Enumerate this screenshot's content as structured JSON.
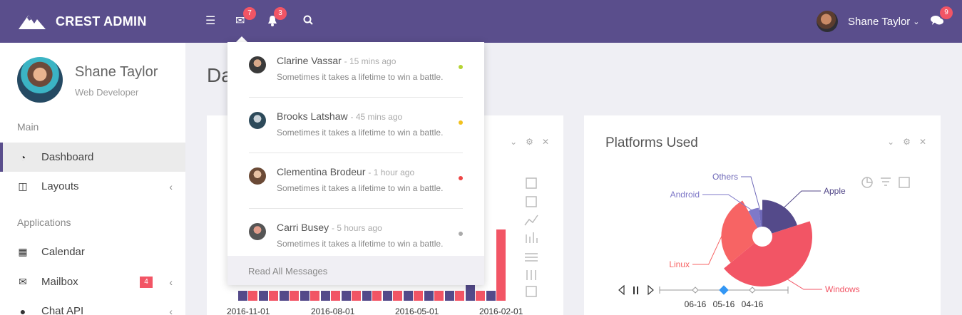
{
  "brand": {
    "name": "CREST ADMIN"
  },
  "topbar": {
    "mail_badge": "7",
    "bell_badge": "3",
    "user_name": "Shane Taylor",
    "chat_badge": "9"
  },
  "sidebar": {
    "user_name": "Shane Taylor",
    "user_role": "Web Developer",
    "sections": [
      "Main",
      "Applications"
    ],
    "items": [
      {
        "label": "Dashboard"
      },
      {
        "label": "Layouts"
      },
      {
        "label": "Calendar"
      },
      {
        "label": "Mailbox",
        "badge": "4"
      },
      {
        "label": "Chat API"
      }
    ]
  },
  "page": {
    "title": "Dashboard"
  },
  "messages": {
    "items": [
      {
        "name": "Clarine Vassar",
        "time": "- 15 mins ago",
        "text": "Sometimes it takes a lifetime to win a battle.",
        "dot_color": "#b5d334"
      },
      {
        "name": "Brooks Latshaw",
        "time": "- 45 mins ago",
        "text": "Sometimes it takes a lifetime to win a battle.",
        "dot_color": "#f2c11d"
      },
      {
        "name": "Clementina Brodeur",
        "time": "- 1 hour ago",
        "text": "Sometimes it takes a lifetime to win a battle.",
        "dot_color": "#ee4545"
      },
      {
        "name": "Carri Busey",
        "time": "- 5 hours ago",
        "text": "Sometimes it takes a lifetime to win a battle.",
        "dot_color": "#aaaaaa"
      }
    ],
    "footer": "Read All Messages"
  },
  "charts": {
    "left": {
      "x_ticks": [
        "2016-11-01",
        "2016-08-01",
        "2016-05-01",
        "2016-02-01"
      ]
    },
    "right": {
      "title": "Platforms Used"
    }
  },
  "chart_data": [
    {
      "type": "bar",
      "x_ticks": [
        "2016-11-01",
        "2016-08-01",
        "2016-05-01",
        "2016-02-01"
      ],
      "series_colors": [
        "#544a8a",
        "#f25565"
      ]
    },
    {
      "type": "pie",
      "title": "Platforms Used",
      "categories": [
        "Apple",
        "Windows",
        "Linux",
        "Android",
        "Others"
      ],
      "values": [
        20,
        44,
        28,
        6,
        2
      ],
      "colors": [
        "#544a8a",
        "#f25565",
        "#f76464",
        "#7f79c8",
        "#6e68b8"
      ],
      "timeline": [
        "06-16",
        "05-16",
        "04-16"
      ],
      "timeline_active": "05-16"
    }
  ],
  "colors": {
    "brand": "#5a4e8c",
    "accent": "#f25565"
  }
}
